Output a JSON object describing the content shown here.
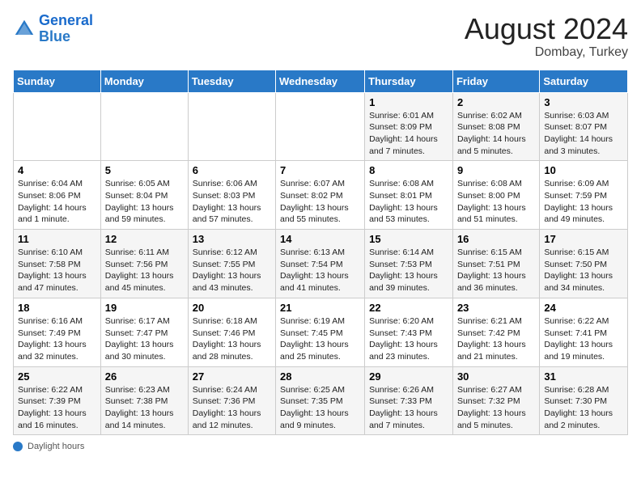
{
  "header": {
    "logo_general": "General",
    "logo_blue": "Blue",
    "month_year": "August 2024",
    "location": "Dombay, Turkey"
  },
  "footer": {
    "label": "Daylight hours"
  },
  "weekdays": [
    "Sunday",
    "Monday",
    "Tuesday",
    "Wednesday",
    "Thursday",
    "Friday",
    "Saturday"
  ],
  "weeks": [
    [
      {
        "day": "",
        "info": ""
      },
      {
        "day": "",
        "info": ""
      },
      {
        "day": "",
        "info": ""
      },
      {
        "day": "",
        "info": ""
      },
      {
        "day": "1",
        "info": "Sunrise: 6:01 AM\nSunset: 8:09 PM\nDaylight: 14 hours and 7 minutes."
      },
      {
        "day": "2",
        "info": "Sunrise: 6:02 AM\nSunset: 8:08 PM\nDaylight: 14 hours and 5 minutes."
      },
      {
        "day": "3",
        "info": "Sunrise: 6:03 AM\nSunset: 8:07 PM\nDaylight: 14 hours and 3 minutes."
      }
    ],
    [
      {
        "day": "4",
        "info": "Sunrise: 6:04 AM\nSunset: 8:06 PM\nDaylight: 14 hours and 1 minute."
      },
      {
        "day": "5",
        "info": "Sunrise: 6:05 AM\nSunset: 8:04 PM\nDaylight: 13 hours and 59 minutes."
      },
      {
        "day": "6",
        "info": "Sunrise: 6:06 AM\nSunset: 8:03 PM\nDaylight: 13 hours and 57 minutes."
      },
      {
        "day": "7",
        "info": "Sunrise: 6:07 AM\nSunset: 8:02 PM\nDaylight: 13 hours and 55 minutes."
      },
      {
        "day": "8",
        "info": "Sunrise: 6:08 AM\nSunset: 8:01 PM\nDaylight: 13 hours and 53 minutes."
      },
      {
        "day": "9",
        "info": "Sunrise: 6:08 AM\nSunset: 8:00 PM\nDaylight: 13 hours and 51 minutes."
      },
      {
        "day": "10",
        "info": "Sunrise: 6:09 AM\nSunset: 7:59 PM\nDaylight: 13 hours and 49 minutes."
      }
    ],
    [
      {
        "day": "11",
        "info": "Sunrise: 6:10 AM\nSunset: 7:58 PM\nDaylight: 13 hours and 47 minutes."
      },
      {
        "day": "12",
        "info": "Sunrise: 6:11 AM\nSunset: 7:56 PM\nDaylight: 13 hours and 45 minutes."
      },
      {
        "day": "13",
        "info": "Sunrise: 6:12 AM\nSunset: 7:55 PM\nDaylight: 13 hours and 43 minutes."
      },
      {
        "day": "14",
        "info": "Sunrise: 6:13 AM\nSunset: 7:54 PM\nDaylight: 13 hours and 41 minutes."
      },
      {
        "day": "15",
        "info": "Sunrise: 6:14 AM\nSunset: 7:53 PM\nDaylight: 13 hours and 39 minutes."
      },
      {
        "day": "16",
        "info": "Sunrise: 6:15 AM\nSunset: 7:51 PM\nDaylight: 13 hours and 36 minutes."
      },
      {
        "day": "17",
        "info": "Sunrise: 6:15 AM\nSunset: 7:50 PM\nDaylight: 13 hours and 34 minutes."
      }
    ],
    [
      {
        "day": "18",
        "info": "Sunrise: 6:16 AM\nSunset: 7:49 PM\nDaylight: 13 hours and 32 minutes."
      },
      {
        "day": "19",
        "info": "Sunrise: 6:17 AM\nSunset: 7:47 PM\nDaylight: 13 hours and 30 minutes."
      },
      {
        "day": "20",
        "info": "Sunrise: 6:18 AM\nSunset: 7:46 PM\nDaylight: 13 hours and 28 minutes."
      },
      {
        "day": "21",
        "info": "Sunrise: 6:19 AM\nSunset: 7:45 PM\nDaylight: 13 hours and 25 minutes."
      },
      {
        "day": "22",
        "info": "Sunrise: 6:20 AM\nSunset: 7:43 PM\nDaylight: 13 hours and 23 minutes."
      },
      {
        "day": "23",
        "info": "Sunrise: 6:21 AM\nSunset: 7:42 PM\nDaylight: 13 hours and 21 minutes."
      },
      {
        "day": "24",
        "info": "Sunrise: 6:22 AM\nSunset: 7:41 PM\nDaylight: 13 hours and 19 minutes."
      }
    ],
    [
      {
        "day": "25",
        "info": "Sunrise: 6:22 AM\nSunset: 7:39 PM\nDaylight: 13 hours and 16 minutes."
      },
      {
        "day": "26",
        "info": "Sunrise: 6:23 AM\nSunset: 7:38 PM\nDaylight: 13 hours and 14 minutes."
      },
      {
        "day": "27",
        "info": "Sunrise: 6:24 AM\nSunset: 7:36 PM\nDaylight: 13 hours and 12 minutes."
      },
      {
        "day": "28",
        "info": "Sunrise: 6:25 AM\nSunset: 7:35 PM\nDaylight: 13 hours and 9 minutes."
      },
      {
        "day": "29",
        "info": "Sunrise: 6:26 AM\nSunset: 7:33 PM\nDaylight: 13 hours and 7 minutes."
      },
      {
        "day": "30",
        "info": "Sunrise: 6:27 AM\nSunset: 7:32 PM\nDaylight: 13 hours and 5 minutes."
      },
      {
        "day": "31",
        "info": "Sunrise: 6:28 AM\nSunset: 7:30 PM\nDaylight: 13 hours and 2 minutes."
      }
    ]
  ]
}
